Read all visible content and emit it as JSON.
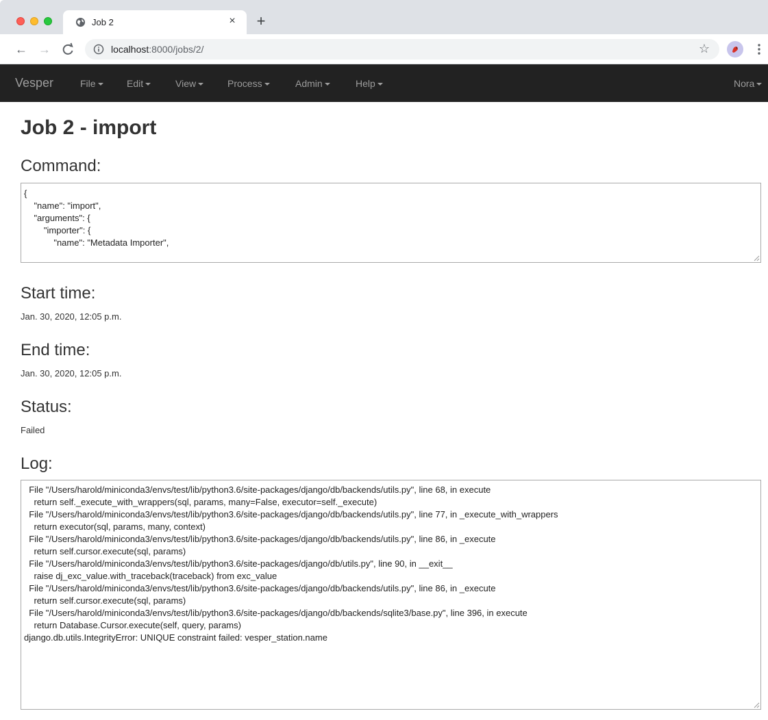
{
  "browser": {
    "tab_title": "Job 2",
    "url_host": "localhost",
    "url_rest": ":8000/jobs/2/",
    "new_tab": "+",
    "close": "×"
  },
  "navbar": {
    "brand": "Vesper",
    "menus": [
      "File",
      "Edit",
      "View",
      "Process",
      "Admin",
      "Help"
    ],
    "user": "Nora"
  },
  "page": {
    "title": "Job 2 - import",
    "command_heading": "Command:",
    "command_text": "{\n    \"name\": \"import\",\n    \"arguments\": {\n        \"importer\": {\n            \"name\": \"Metadata Importer\",",
    "start_heading": "Start time:",
    "start_time": "Jan. 30, 2020, 12:05 p.m.",
    "end_heading": "End time:",
    "end_time": "Jan. 30, 2020, 12:05 p.m.",
    "status_heading": "Status:",
    "status": "Failed",
    "log_heading": "Log:",
    "log_text": "  File \"/Users/harold/miniconda3/envs/test/lib/python3.6/site-packages/django/db/backends/utils.py\", line 68, in execute\n    return self._execute_with_wrappers(sql, params, many=False, executor=self._execute)\n  File \"/Users/harold/miniconda3/envs/test/lib/python3.6/site-packages/django/db/backends/utils.py\", line 77, in _execute_with_wrappers\n    return executor(sql, params, many, context)\n  File \"/Users/harold/miniconda3/envs/test/lib/python3.6/site-packages/django/db/backends/utils.py\", line 86, in _execute\n    return self.cursor.execute(sql, params)\n  File \"/Users/harold/miniconda3/envs/test/lib/python3.6/site-packages/django/db/utils.py\", line 90, in __exit__\n    raise dj_exc_value.with_traceback(traceback) from exc_value\n  File \"/Users/harold/miniconda3/envs/test/lib/python3.6/site-packages/django/db/backends/utils.py\", line 86, in _execute\n    return self.cursor.execute(sql, params)\n  File \"/Users/harold/miniconda3/envs/test/lib/python3.6/site-packages/django/db/backends/sqlite3/base.py\", line 396, in execute\n    return Database.Cursor.execute(self, query, params)\ndjango.db.utils.IntegrityError: UNIQUE constraint failed: vesper_station.name"
  },
  "colors": {
    "navbar_bg": "#222222",
    "navbar_text": "#9d9d9d",
    "heading_text": "#333333"
  }
}
